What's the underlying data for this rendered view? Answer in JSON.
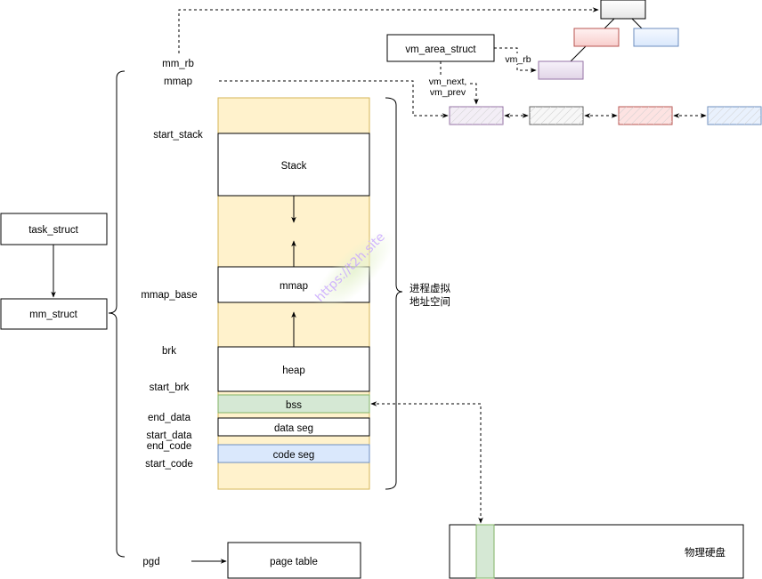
{
  "colors": {
    "address_space_fill": "#fff2cc",
    "address_space_stroke": "#d6b656",
    "bss_fill": "#d5e8d4",
    "bss_stroke": "#82b366",
    "code_fill": "#dae8fc",
    "code_stroke": "#6c8ebf",
    "purple_fill": "#e1d5e7",
    "purple_stroke": "#9673a6",
    "red_fill": "#f8cecc",
    "red_stroke": "#b85450",
    "gray_fill": "#f5f5f5",
    "gray_stroke": "#666666",
    "blue_fill": "#dae8fc",
    "blue_stroke": "#6c8ebf",
    "watermark": "#c9a8ff"
  },
  "structs": {
    "task_struct": "task_struct",
    "mm_struct": "mm_struct",
    "vm_area_struct": "vm_area_struct",
    "page_table": "page table",
    "physical_disk": "物理硬盘"
  },
  "mm_fields": {
    "mm_rb": "mm_rb",
    "mmap": "mmap",
    "start_stack": "start_stack",
    "mmap_base": "mmap_base",
    "brk": "brk",
    "start_brk": "start_brk",
    "end_data": "end_data",
    "start_data": "start_data",
    "end_code": "end_code",
    "start_code": "start_code",
    "pgd": "pgd"
  },
  "segments": {
    "stack": "Stack",
    "mmap": "mmap",
    "heap": "heap",
    "bss": "bss",
    "data": "data seg",
    "code": "code seg"
  },
  "address_space_label": [
    "进程虚拟",
    "地址空间"
  ],
  "edge_labels": {
    "vm_rb": "vm_rb",
    "vm_next_prev": [
      "vm_next,",
      "vm_prev"
    ]
  },
  "watermark": "https://t2h.site"
}
